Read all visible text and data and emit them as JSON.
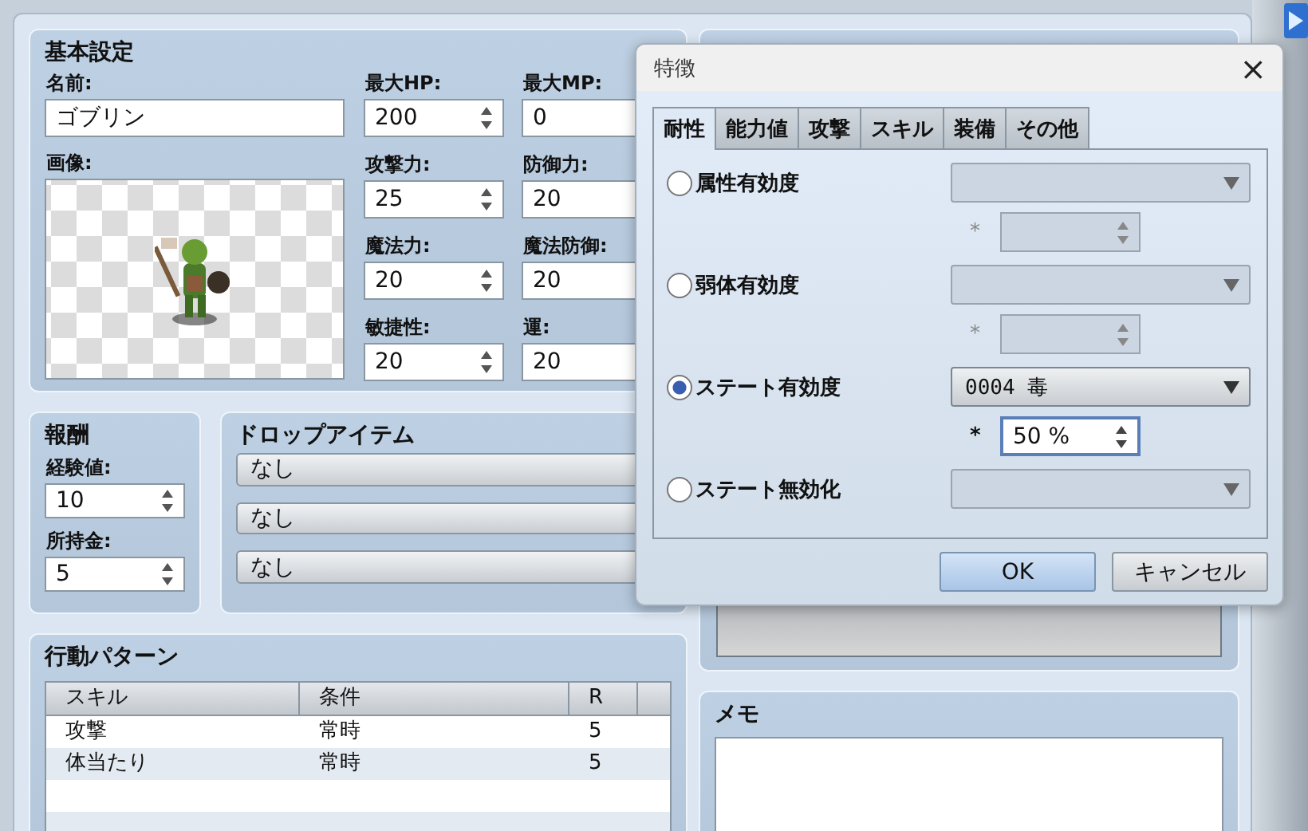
{
  "editor": {
    "basic": {
      "title": "基本設定",
      "name_label": "名前:",
      "name_value": "ゴブリン",
      "image_label": "画像:",
      "stats": [
        {
          "label": "最大HP:",
          "value": "200"
        },
        {
          "label": "最大MP:",
          "value": "0"
        },
        {
          "label": "攻撃力:",
          "value": "25"
        },
        {
          "label": "防御力:",
          "value": "20"
        },
        {
          "label": "魔法力:",
          "value": "20"
        },
        {
          "label": "魔法防御:",
          "value": "20"
        },
        {
          "label": "敏捷性:",
          "value": "20"
        },
        {
          "label": "運:",
          "value": "20"
        }
      ]
    },
    "reward": {
      "title": "報酬",
      "fields": [
        {
          "label": "経験値:",
          "value": "10"
        },
        {
          "label": "所持金:",
          "value": "5"
        }
      ]
    },
    "drops": {
      "title": "ドロップアイテム",
      "items": [
        "なし",
        "なし",
        "なし"
      ]
    },
    "actions": {
      "title": "行動パターン",
      "columns": [
        "スキル",
        "条件",
        "R"
      ],
      "rows": [
        {
          "skill": "攻撃",
          "condition": "常時",
          "rating": "5"
        },
        {
          "skill": "体当たり",
          "condition": "常時",
          "rating": "5"
        }
      ]
    },
    "memo": {
      "title": "メモ"
    }
  },
  "dialog": {
    "title": "特徴",
    "close": "×",
    "tabs": [
      {
        "label": "耐性",
        "selected": true
      },
      {
        "label": "能力値",
        "selected": false
      },
      {
        "label": "攻撃",
        "selected": false
      },
      {
        "label": "スキル",
        "selected": false
      },
      {
        "label": "装備",
        "selected": false
      },
      {
        "label": "その他",
        "selected": false
      }
    ],
    "options": [
      {
        "label": "属性有効度",
        "selected": false,
        "rate_mark": "*"
      },
      {
        "label": "弱体有効度",
        "selected": false,
        "rate_mark": "*"
      },
      {
        "label": "ステート有効度",
        "selected": true,
        "value": "0004 毒",
        "rate_mark": "*",
        "rate": "50 %"
      },
      {
        "label": "ステート無効化",
        "selected": false
      }
    ],
    "buttons": [
      {
        "label": "OK",
        "kind": "primary"
      },
      {
        "label": "キャンセル",
        "kind": "normal"
      }
    ]
  }
}
